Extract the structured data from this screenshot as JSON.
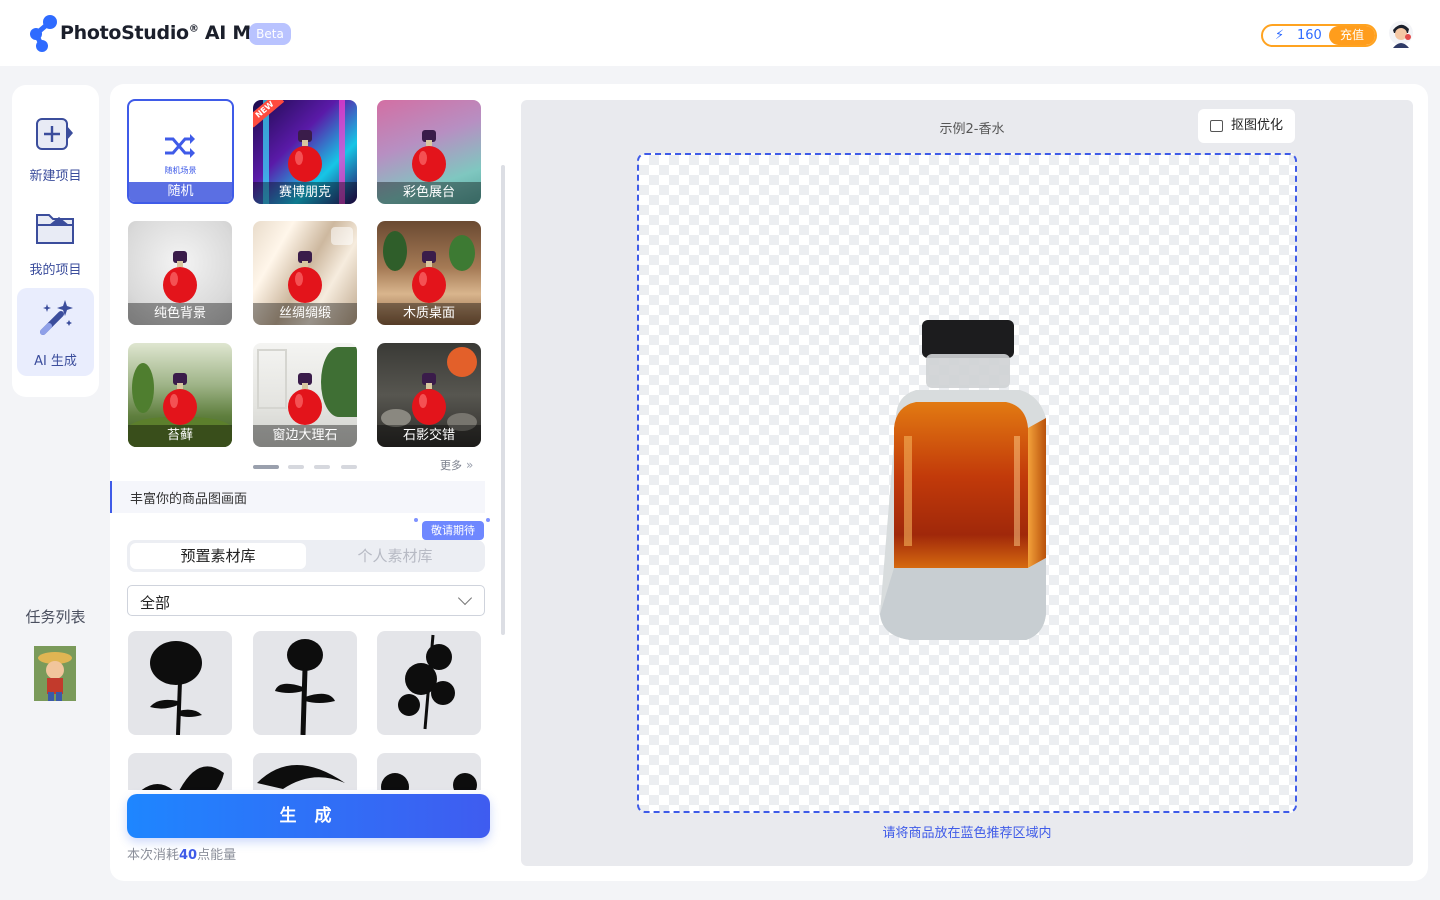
{
  "header": {
    "logo_text": "PhotoStudio",
    "logo_reg": "®",
    "logo_suffix": " AI MC",
    "beta": "Beta",
    "credits": "160",
    "topup": "充值"
  },
  "rail": {
    "items": [
      {
        "label": "新建项目",
        "icon": "new-project-icon"
      },
      {
        "label": "我的项目",
        "icon": "folder-icon"
      },
      {
        "label": "AI 生成",
        "icon": "magic-wand-icon",
        "active": true
      }
    ],
    "task_title": "任务列表"
  },
  "scenes": {
    "items": [
      {
        "label": "随机",
        "sub": "随机场景"
      },
      {
        "label": "赛博朋克",
        "badge": "NEW"
      },
      {
        "label": "彩色展台"
      },
      {
        "label": "纯色背景"
      },
      {
        "label": "丝绸绸缎"
      },
      {
        "label": "木质桌面"
      },
      {
        "label": "苔藓"
      },
      {
        "label": "窗边大理石"
      },
      {
        "label": "石影交错"
      }
    ],
    "more": "更多",
    "page_count": 4,
    "current_page": 1
  },
  "description_placeholder": "丰富你的商品图画面",
  "library": {
    "tab_preset": "预置素材库",
    "tab_personal": "个人素材库",
    "coming_soon": "敬请期待",
    "filter_value": "全部"
  },
  "generate": {
    "button": "生 成",
    "cost_prefix": "本次消耗",
    "cost_value": "40",
    "cost_suffix": "点能量"
  },
  "preview": {
    "title": "示例2-香水",
    "matting_button": "抠图优化",
    "hint": "请将商品放在蓝色推荐区域内"
  },
  "colors": {
    "accent": "#3f5be8",
    "generate_gradient_start": "#1e86ff",
    "credit_orange": "#ff9d1c"
  }
}
